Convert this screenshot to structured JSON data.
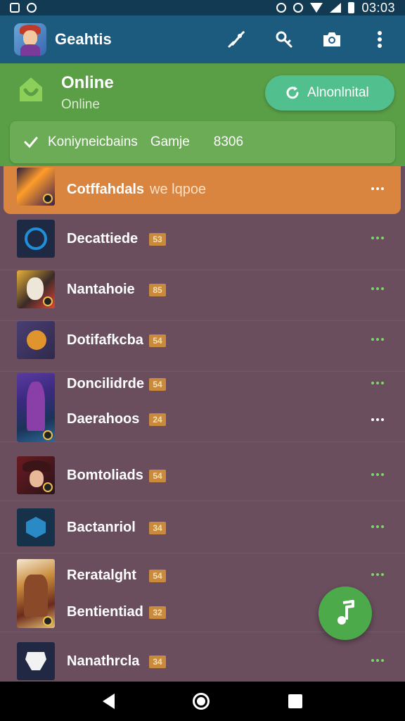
{
  "status_bar": {
    "time": "03:03"
  },
  "app_bar": {
    "title": "Geahtis",
    "actions": [
      "rocket-icon",
      "key-icon",
      "camera-icon",
      "more-vert-icon"
    ]
  },
  "online_header": {
    "title": "Online",
    "subtitle": "Online",
    "pill_label": "Alnonlnital",
    "banner": {
      "text1": "Koniyneicbains",
      "text2": "Gamje",
      "text3": "8306"
    }
  },
  "list": {
    "active": {
      "label": "Cotffahdals",
      "sub": "we lqpoe"
    },
    "items": [
      {
        "label": "Decattiede",
        "badge": "53"
      },
      {
        "label": "Nantahoie",
        "badge": "85"
      },
      {
        "label": "Dotifafkcba",
        "badge": "54"
      },
      {
        "label": "Doncilidrde",
        "badge": "54"
      },
      {
        "label": "Daerahoos",
        "badge": "24"
      },
      {
        "label": "Bomtoliads",
        "badge": "54"
      },
      {
        "label": "Bactanriol",
        "badge": "34"
      },
      {
        "label": "Reratalght",
        "badge": "54"
      },
      {
        "label": "Bentientiad",
        "badge": "32"
      },
      {
        "label": "Nanathrcla",
        "badge": "34"
      }
    ]
  },
  "colors": {
    "app_bar": "#1c5a7e",
    "online_header": "#5a9e46",
    "active_row": "#d9853f",
    "list_bg": "#6a4e5e",
    "fab": "#4caa4a"
  }
}
